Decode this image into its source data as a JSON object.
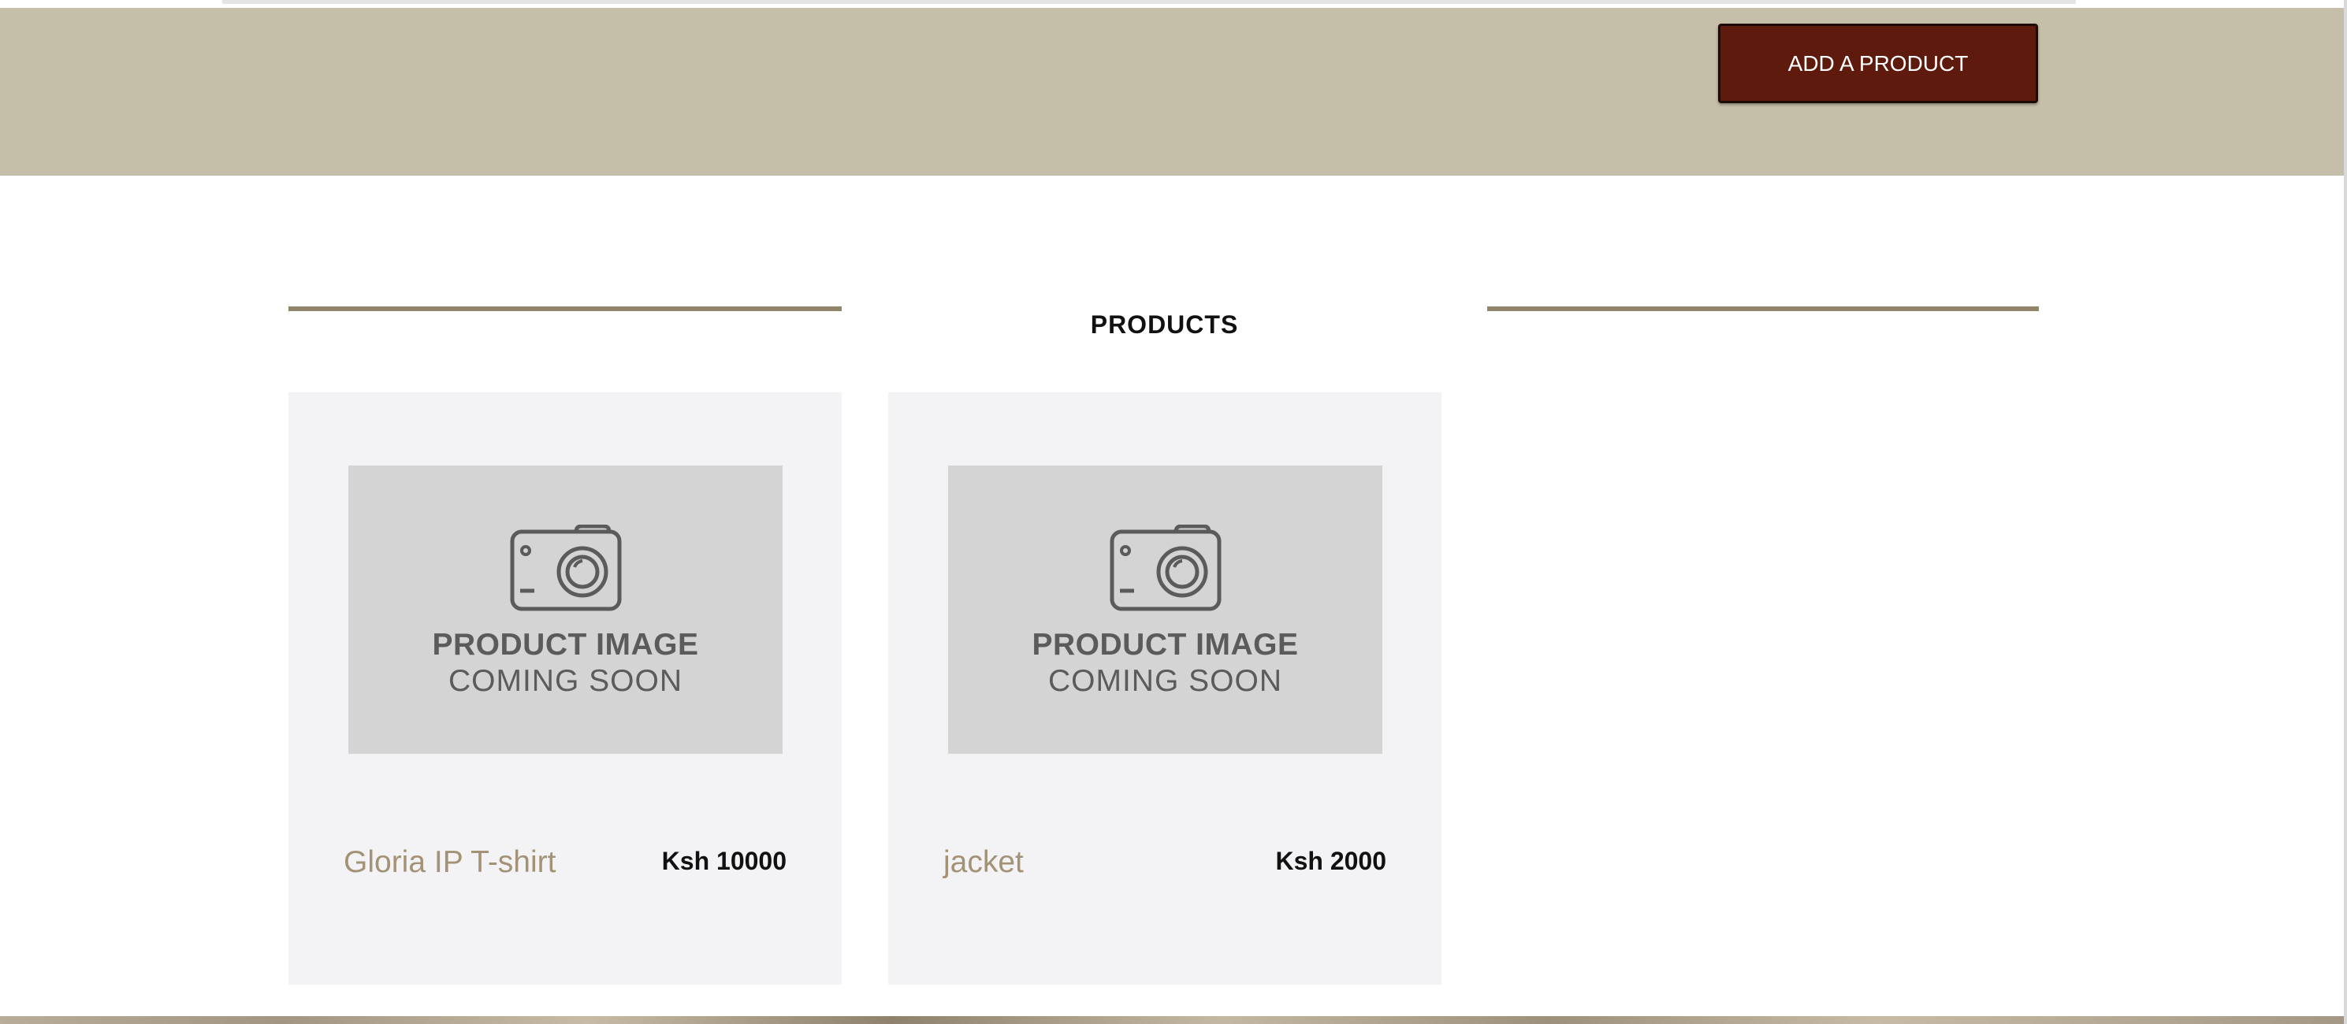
{
  "colors": {
    "header_bg": "#c5bea8",
    "brand": "#5e1b0d",
    "rule": "#918569",
    "card_bg": "#f3f3f5",
    "name_color": "#a39276"
  },
  "header": {
    "add_product_label": "ADD A PRODUCT"
  },
  "products_section": {
    "title": "PRODUCTS",
    "items": [
      {
        "name": "Gloria IP T-shirt",
        "price": "Ksh 10000",
        "image": {
          "icon": "camera-icon",
          "line1": "PRODUCT IMAGE",
          "line2": "COMING SOON"
        }
      },
      {
        "name": "jacket",
        "price": "Ksh 2000",
        "image": {
          "icon": "camera-icon",
          "line1": "PRODUCT IMAGE",
          "line2": "COMING SOON"
        }
      }
    ]
  }
}
